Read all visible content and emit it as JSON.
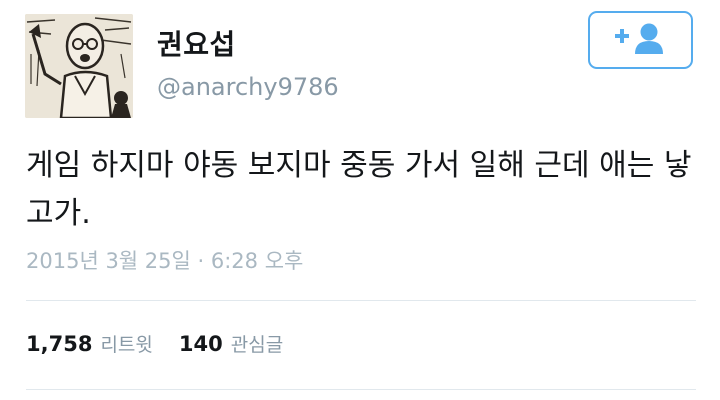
{
  "user": {
    "display_name": "권요섭",
    "screen_name": "@anarchy9786"
  },
  "follow_button": {
    "icon": "add-user-icon",
    "color": "#55acee"
  },
  "tweet": {
    "text": "게임 하지마 야동 보지마 중동 가서 일해 근데 애는 낳고가.",
    "timestamp": "2015년 3월 25일 · 6:28 오후"
  },
  "stats": {
    "retweets": {
      "count": "1,758",
      "label": "리트윗"
    },
    "likes": {
      "count": "140",
      "label": "관심글"
    }
  },
  "colors": {
    "primary_text": "#14171a",
    "secondary_text": "#8899a6",
    "timestamp": "#aab8c2",
    "divider": "#e1e8ed"
  }
}
